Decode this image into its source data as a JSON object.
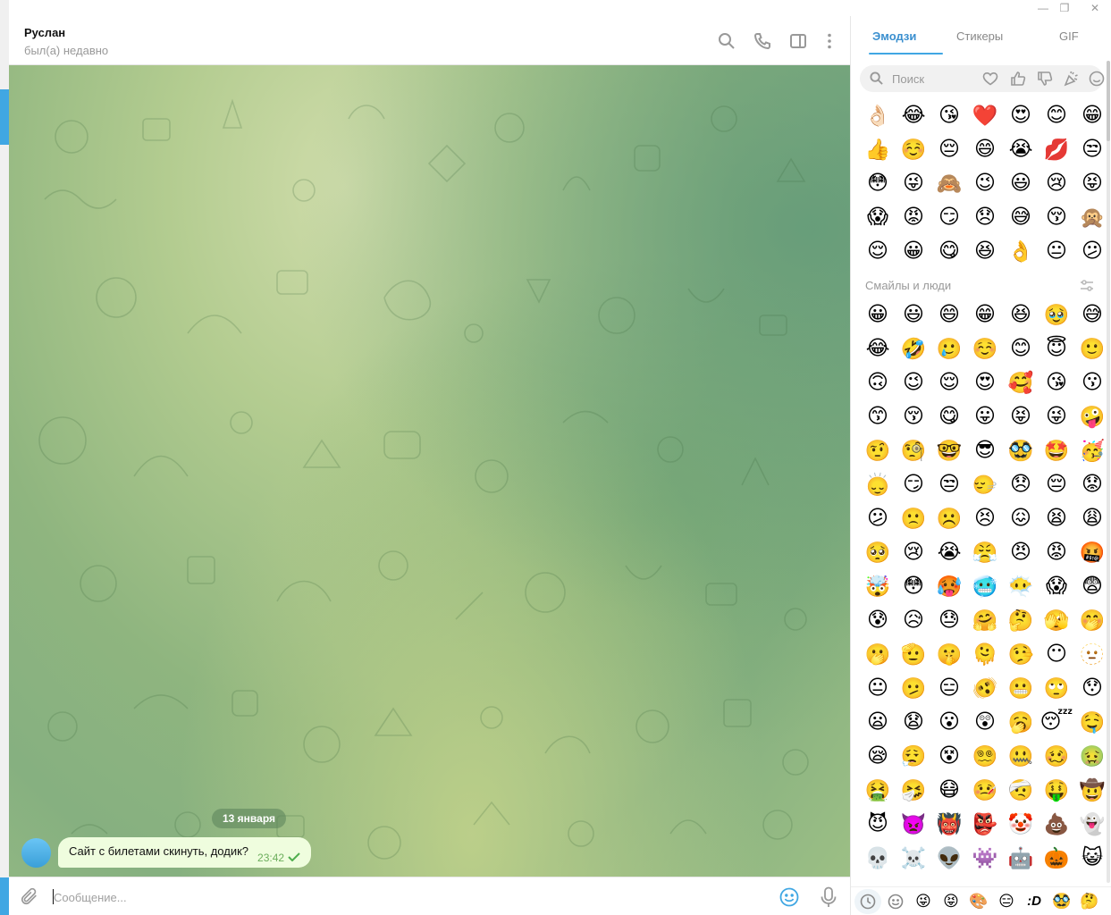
{
  "chat": {
    "name": "Руслан",
    "status": "был(а) недавно"
  },
  "messages": [
    {
      "date": "13 января",
      "text": "Сайт с билетами скинуть, додик?",
      "time": "23:42",
      "read": true
    }
  ],
  "composer": {
    "placeholder": "Сообщение..."
  },
  "panel": {
    "tabs": [
      {
        "label": "Эмодзи",
        "active": true
      },
      {
        "label": "Стикеры",
        "active": false
      },
      {
        "label": "GIF",
        "active": false
      }
    ],
    "search_placeholder": "Поиск",
    "recent": [
      "👌🏻",
      "😂",
      "😘",
      "❤️",
      "😍",
      "😊",
      "😁",
      "👍",
      "☺️",
      "😔",
      "😄",
      "😭",
      "💋",
      "😒",
      "😳",
      "😜",
      "🙈",
      "😉",
      "😃",
      "😢",
      "😝",
      "😱",
      "😡",
      "😏",
      "😞",
      "😅",
      "😚",
      "🙊",
      "😌",
      "😀",
      "😋",
      "😆",
      "👌",
      "😐",
      "😕"
    ],
    "section_title": "Смайлы и люди",
    "smileys": [
      "😀",
      "😃",
      "😄",
      "😁",
      "😆",
      "🥹",
      "😅",
      "😂",
      "🤣",
      "🥲",
      "☺️",
      "😊",
      "😇",
      "🙂",
      "🙃",
      "😉",
      "😌",
      "😍",
      "🥰",
      "😘",
      "😗",
      "😙",
      "😚",
      "😋",
      "😛",
      "😝",
      "😜",
      "🤪",
      "🤨",
      "🧐",
      "🤓",
      "😎",
      "🥸",
      "🤩",
      "🥳",
      "🙂‍↕️",
      "😏",
      "😒",
      "🙂‍↔️",
      "😞",
      "😔",
      "😟",
      "😕",
      "🙁",
      "☹️",
      "😣",
      "😖",
      "😫",
      "😩",
      "🥺",
      "😢",
      "😭",
      "😤",
      "😠",
      "😡",
      "🤬",
      "🤯",
      "😳",
      "🥵",
      "🥶",
      "😶‍🌫️",
      "😱",
      "😨",
      "😰",
      "😥",
      "😓",
      "🤗",
      "🤔",
      "🫣",
      "🤭",
      "🫢",
      "🫡",
      "🤫",
      "🫠",
      "🤥",
      "😶",
      "🫥",
      "😐",
      "🫤",
      "😑",
      "🫨",
      "😬",
      "🙄",
      "😯",
      "😦",
      "😧",
      "😮",
      "😲",
      "🥱",
      "😴",
      "🤤",
      "😪",
      "😮‍💨",
      "😵",
      "😵‍💫",
      "🤐",
      "🥴",
      "🤢",
      "🤮",
      "🤧",
      "😷",
      "🤒",
      "🤕",
      "🤑",
      "🤠",
      "😈",
      "👿",
      "👹",
      "👺",
      "🤡",
      "💩",
      "👻",
      "💀",
      "☠️",
      "👽",
      "👾",
      "🤖",
      "🎃",
      "😺",
      "😸",
      "😹",
      "😻",
      "😼",
      "😽",
      "🙀"
    ],
    "categories": [
      "recent-icon",
      "smiley-icon",
      "😀",
      "😛",
      "🎨",
      "🍯",
      "😝",
      "🥸",
      "👅"
    ],
    "category_glyphs": [
      "",
      "",
      "😜",
      "😝",
      "🎨",
      "😑",
      ":D",
      "🥸",
      "🤔"
    ]
  },
  "window": {
    "minimize": "—",
    "restore": "❐",
    "close": "✕"
  }
}
